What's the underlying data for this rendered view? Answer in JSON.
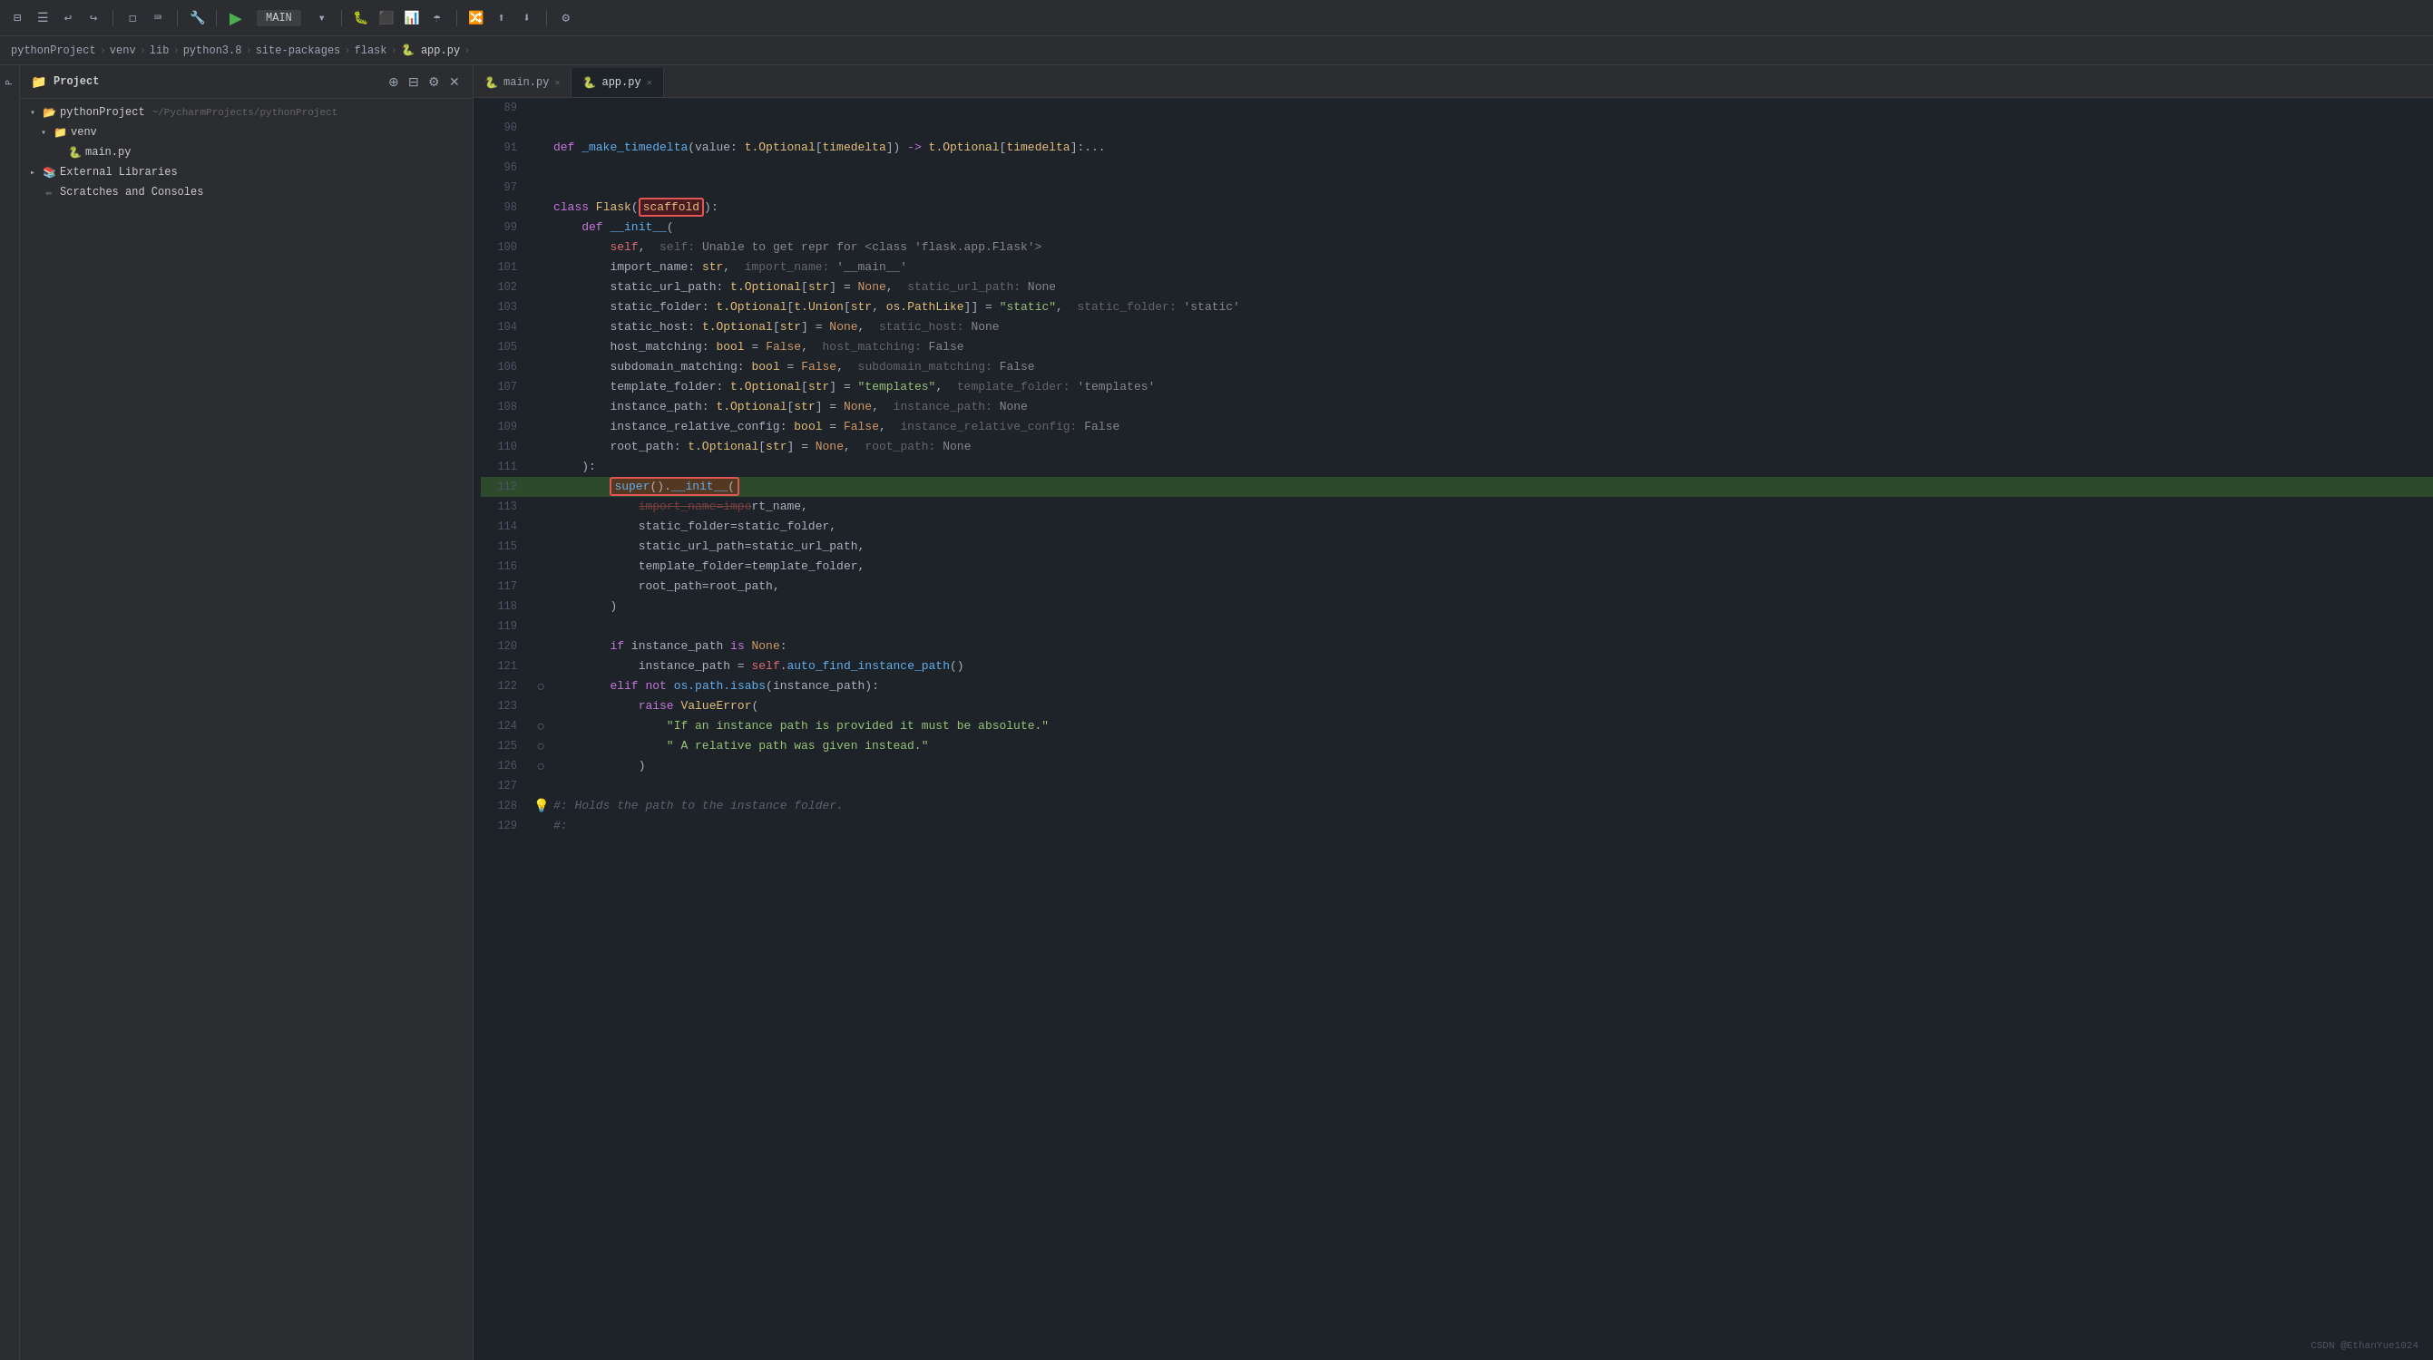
{
  "toolbar": {
    "main_label": "MAIN",
    "run_icon": "▶",
    "icons": [
      "↩",
      "↪",
      "⊟",
      "⊞",
      "☰"
    ]
  },
  "breadcrumb": {
    "items": [
      "pythonProject",
      "venv",
      "lib",
      "python3.8",
      "site-packages",
      "flask",
      "app.py"
    ]
  },
  "sidebar": {
    "title": "Project",
    "tree": [
      {
        "label": "pythonProject",
        "sublabel": "~/PycharmProjects/pythonProject",
        "level": 0,
        "type": "project",
        "open": true
      },
      {
        "label": "venv",
        "level": 1,
        "type": "folder",
        "open": true
      },
      {
        "label": "External Libraries",
        "level": 0,
        "type": "external"
      },
      {
        "label": "Scratches and Consoles",
        "level": 0,
        "type": "scratches"
      }
    ],
    "main_py": "main.py"
  },
  "editor": {
    "tabs": [
      {
        "label": "main.py",
        "active": false
      },
      {
        "label": "app.py",
        "active": true
      }
    ]
  },
  "code": {
    "lines": [
      {
        "num": 89,
        "content": "",
        "highlight": false
      },
      {
        "num": 90,
        "content": "",
        "highlight": false
      },
      {
        "num": 91,
        "content": "def _make_timedelta(value: t.Optional[timedelta]) -> t.Optional[timedelta]:...",
        "highlight": false
      },
      {
        "num": 96,
        "content": "",
        "highlight": false
      },
      {
        "num": 97,
        "content": "",
        "highlight": false
      },
      {
        "num": 98,
        "content": "class Flask(scaffold):",
        "highlight": false,
        "has_red_box": "scaffold"
      },
      {
        "num": 99,
        "content": "    def __init__(",
        "highlight": false
      },
      {
        "num": 100,
        "content": "        self,  self: Unable to get repr for <class 'flask.app.Flask'>",
        "highlight": false
      },
      {
        "num": 101,
        "content": "        import_name: str,  import_name: '__main__'",
        "highlight": false
      },
      {
        "num": 102,
        "content": "        static_url_path: t.Optional[str] = None,  static_url_path: None",
        "highlight": false
      },
      {
        "num": 103,
        "content": "        static_folder: t.Optional[t.Union[str, os.PathLike]] = \"static\",  static_folder: 'static'",
        "highlight": false
      },
      {
        "num": 104,
        "content": "        static_host: t.Optional[str] = None,  static_host: None",
        "highlight": false
      },
      {
        "num": 105,
        "content": "        host_matching: bool = False,  host_matching: False",
        "highlight": false
      },
      {
        "num": 106,
        "content": "        subdomain_matching: bool = False,  subdomain_matching: False",
        "highlight": false
      },
      {
        "num": 107,
        "content": "        template_folder: t.Optional[str] = \"templates\",  template_folder: 'templates'",
        "highlight": false
      },
      {
        "num": 108,
        "content": "        instance_path: t.Optional[str] = None,  instance_path: None",
        "highlight": false
      },
      {
        "num": 109,
        "content": "        instance_relative_config: bool = False,  instance_relative_config: False",
        "highlight": false
      },
      {
        "num": 110,
        "content": "        root_path: t.Optional[str] = None,  root_path: None",
        "highlight": false
      },
      {
        "num": 111,
        "content": "    ):",
        "highlight": false
      },
      {
        "num": 112,
        "content": "        super().__init__(",
        "highlight": true
      },
      {
        "num": 113,
        "content": "            import_name=import_name,",
        "highlight": false
      },
      {
        "num": 114,
        "content": "            static_folder=static_folder,",
        "highlight": false
      },
      {
        "num": 115,
        "content": "            static_url_path=static_url_path,",
        "highlight": false
      },
      {
        "num": 116,
        "content": "            template_folder=template_folder,",
        "highlight": false
      },
      {
        "num": 117,
        "content": "            root_path=root_path,",
        "highlight": false
      },
      {
        "num": 118,
        "content": "        )",
        "highlight": false
      },
      {
        "num": 119,
        "content": "",
        "highlight": false
      },
      {
        "num": 120,
        "content": "        if instance_path is None:",
        "highlight": false
      },
      {
        "num": 121,
        "content": "            instance_path = self.auto_find_instance_path()",
        "highlight": false
      },
      {
        "num": 122,
        "content": "        elif not os.path.isabs(instance_path):",
        "highlight": false
      },
      {
        "num": 123,
        "content": "            raise ValueError(",
        "highlight": false
      },
      {
        "num": 124,
        "content": "                \"If an instance path is provided it must be absolute.\"",
        "highlight": false
      },
      {
        "num": 125,
        "content": "                \" A relative path was given instead.\"",
        "highlight": false
      },
      {
        "num": 126,
        "content": "            )",
        "highlight": false
      },
      {
        "num": 127,
        "content": "",
        "highlight": false
      },
      {
        "num": 128,
        "content": "#: Holds the path to the instance folder.",
        "highlight": false,
        "has_bulb": true
      },
      {
        "num": 129,
        "content": "#:",
        "highlight": false
      }
    ]
  },
  "watermark": "CSDN @EthanYue1024"
}
